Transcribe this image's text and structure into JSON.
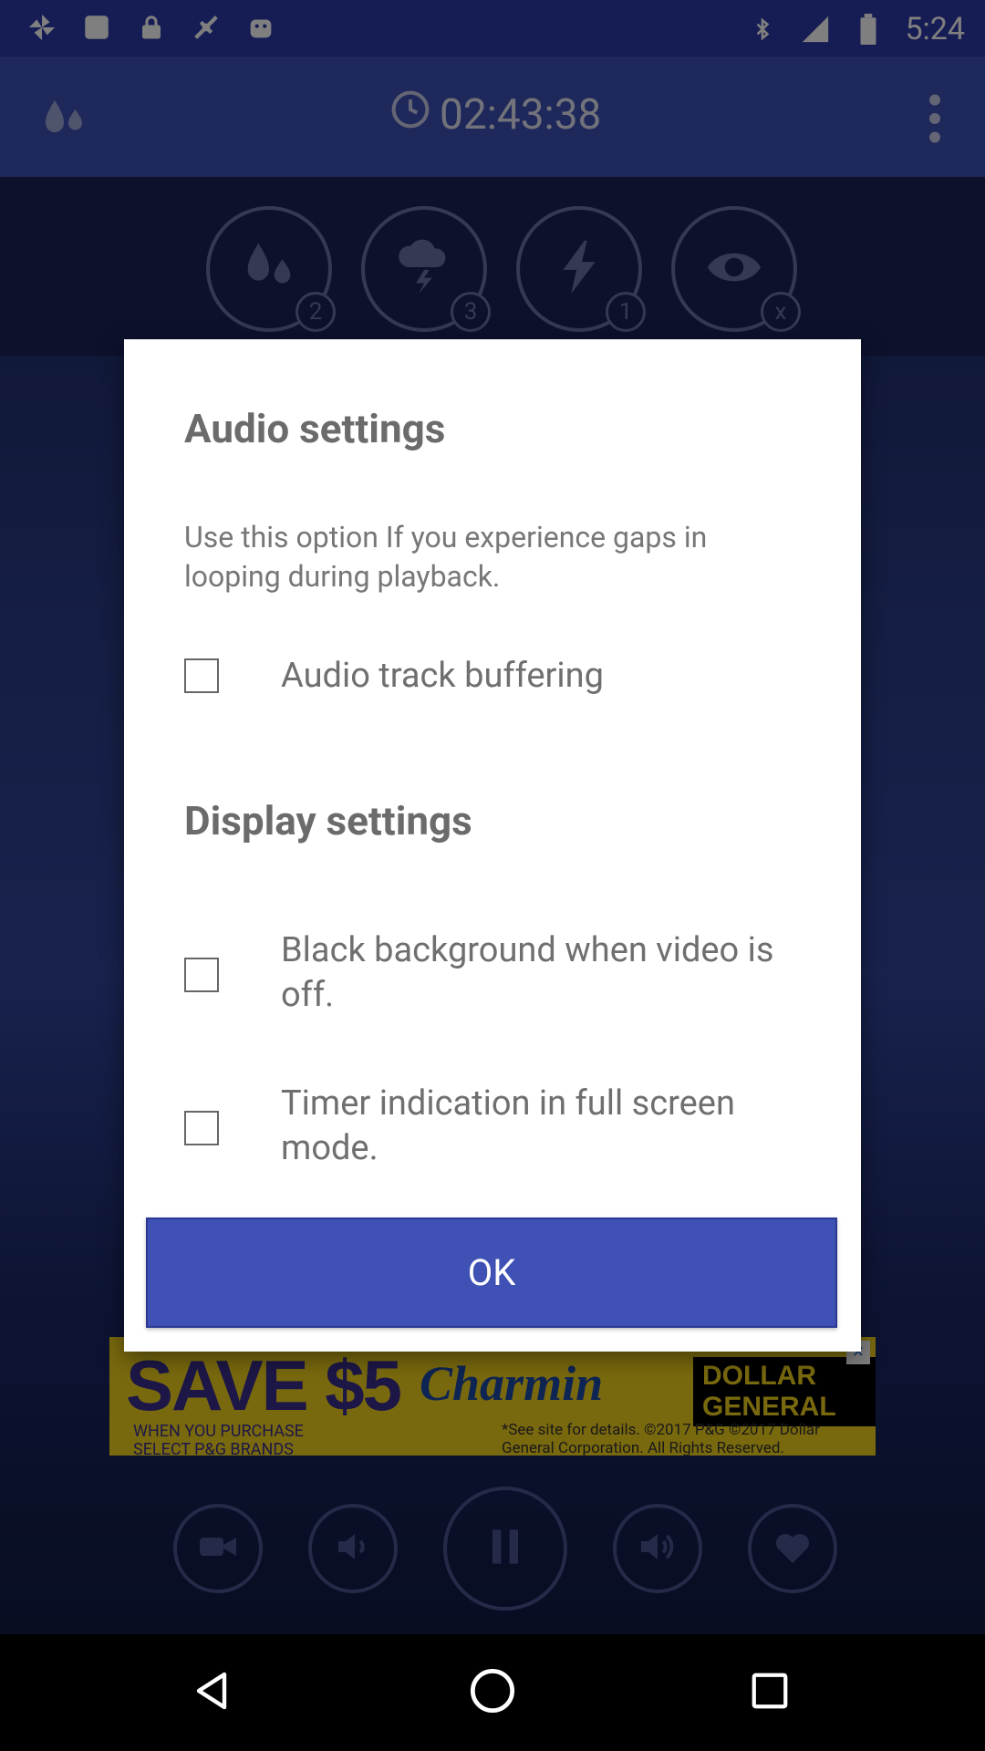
{
  "status_bar": {
    "time": "5:24",
    "icons": [
      "pinwheel-icon",
      "stop-icon",
      "lock-icon",
      "fake-gps-icon",
      "android-icon",
      "bluetooth-icon",
      "signal-icon",
      "battery-icon"
    ]
  },
  "app_bar": {
    "timer": "02:43:38",
    "icons": [
      "rain-logo-icon",
      "clock-icon",
      "overflow-menu-icon"
    ]
  },
  "sound_buttons": [
    {
      "icon": "raindrops-icon",
      "count": "2"
    },
    {
      "icon": "thunderstorm-icon",
      "count": "3"
    },
    {
      "icon": "lightning-icon",
      "count": "1"
    },
    {
      "icon": "eye-icon",
      "count": "x"
    }
  ],
  "ad": {
    "headline": "SAVE $5",
    "sub": "WHEN YOU PURCHASE SELECT P&G BRANDS",
    "brand": "Charmin",
    "store": "DOLLAR GENERAL",
    "fine_print": "*See site for details. ©2017 P&G ©2017 Dollar General Corporation. All Rights Reserved."
  },
  "controls": [
    "video-camera-icon",
    "volume-down-icon",
    "pause-icon",
    "volume-up-icon",
    "heart-icon"
  ],
  "dialog": {
    "audio_title": "Audio settings",
    "audio_description": "Use this option If you experience gaps in looping during playback.",
    "options": [
      {
        "label": "Audio track buffering",
        "checked": false
      },
      {
        "label": "Black background when video is off.",
        "checked": false
      },
      {
        "label": "Timer indication in full screen mode.",
        "checked": false
      }
    ],
    "display_title": "Display settings",
    "ok_label": "OK"
  },
  "colors": {
    "primary": "#3f51b5",
    "status_bar": "#2c39a8",
    "dialog_bg": "#ffffff"
  }
}
